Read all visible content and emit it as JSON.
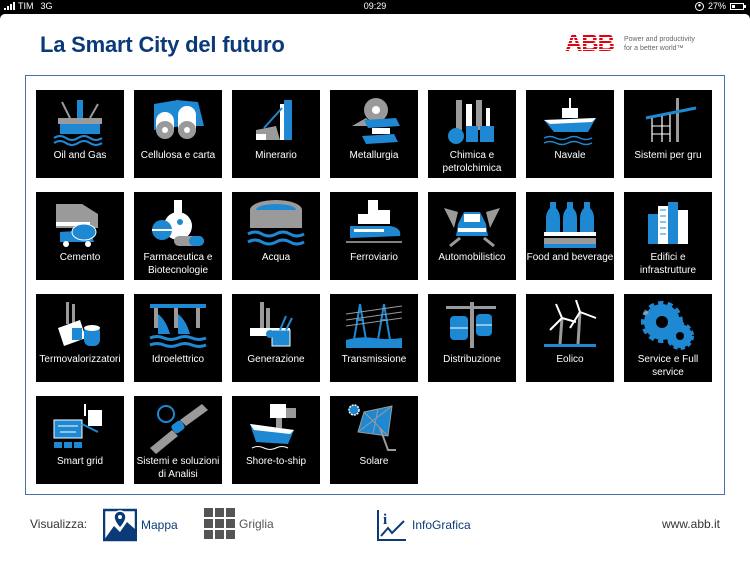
{
  "status_bar": {
    "carrier": "TIM",
    "network": "3G",
    "time": "09:29",
    "battery": "27%",
    "battery_level": 0.27
  },
  "header": {
    "title": "La Smart City del futuro",
    "brand": "ABB",
    "tagline_line1": "Power and productivity",
    "tagline_line2": "for a better world™"
  },
  "colors": {
    "brand_blue": "#0b3a78",
    "icon_blue": "#1e88d2",
    "abb_red": "#e3000f",
    "tile_bg": "#000000"
  },
  "tiles": [
    {
      "label": "Oil and Gas",
      "icon": "oil-rig-icon"
    },
    {
      "label": "Cellulosa e carta",
      "icon": "paper-rolls-icon"
    },
    {
      "label": "Minerario",
      "icon": "mine-icon"
    },
    {
      "label": "Metallurgia",
      "icon": "steel-beam-icon"
    },
    {
      "label": "Chimica e petrolchimica",
      "icon": "chemical-plant-icon"
    },
    {
      "label": "Navale",
      "icon": "ship-icon"
    },
    {
      "label": "Sistemi per gru",
      "icon": "crane-icon"
    },
    {
      "label": "Cemento",
      "icon": "cement-truck-icon"
    },
    {
      "label": "Farmaceutica e Biotecnologie",
      "icon": "flask-pills-icon"
    },
    {
      "label": "Acqua",
      "icon": "water-tank-icon"
    },
    {
      "label": "Ferroviario",
      "icon": "train-icon"
    },
    {
      "label": "Automobilistico",
      "icon": "car-robots-icon"
    },
    {
      "label": "Food and beverage",
      "icon": "bottles-icon"
    },
    {
      "label": "Edifici e infrastrutture",
      "icon": "buildings-icon"
    },
    {
      "label": "Termovalorizzatori",
      "icon": "waste-plant-icon"
    },
    {
      "label": "Idroelettrico",
      "icon": "dam-icon"
    },
    {
      "label": "Generazione",
      "icon": "power-plant-icon"
    },
    {
      "label": "Transmissione",
      "icon": "pylon-icon"
    },
    {
      "label": "Distribuzione",
      "icon": "transformer-pole-icon"
    },
    {
      "label": "Eolico",
      "icon": "wind-turbine-icon"
    },
    {
      "label": "Service e Full service",
      "icon": "gears-icon"
    },
    {
      "label": "Smart grid",
      "icon": "smart-grid-icon"
    },
    {
      "label": "Sistemi e soluzioni di Analisi",
      "icon": "satellite-icon"
    },
    {
      "label": "Shore-to-ship",
      "icon": "shore-ship-icon"
    },
    {
      "label": "Solare",
      "icon": "solar-dish-icon"
    }
  ],
  "footer": {
    "view_label": "Visualizza:",
    "map_label": "Mappa",
    "grid_label": "Griglia",
    "infographic_label": "InfoGrafica",
    "website": "www.abb.it"
  }
}
